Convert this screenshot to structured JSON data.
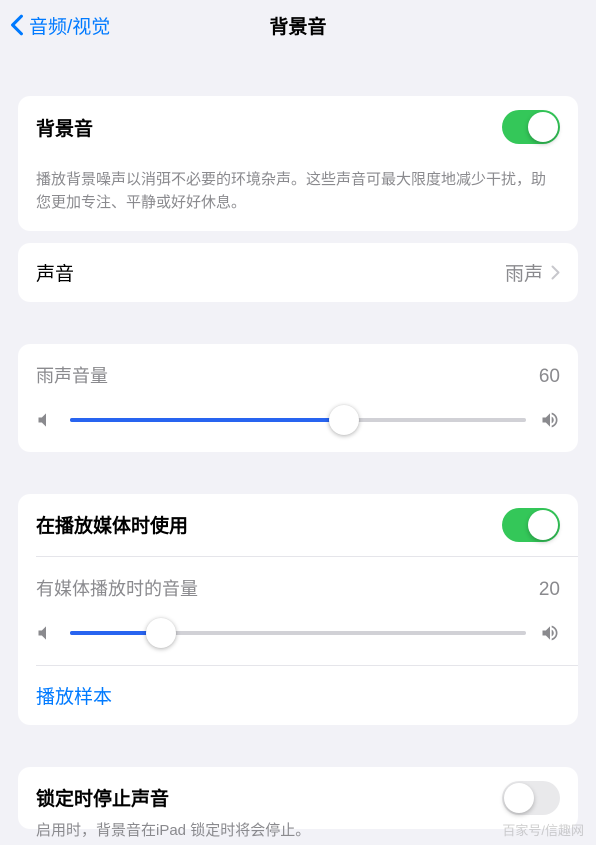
{
  "header": {
    "back_label": "音频/视觉",
    "title": "背景音"
  },
  "main_toggle": {
    "label": "背景音",
    "on": true,
    "description": "播放背景噪声以消弭不必要的环境杂声。这些声音可最大限度地减少干扰，助您更加专注、平静或好好休息。"
  },
  "sound_select": {
    "label": "声音",
    "value": "雨声"
  },
  "rain_volume": {
    "label": "雨声音量",
    "value": 60
  },
  "media": {
    "use_label": "在播放媒体时使用",
    "use_on": true,
    "volume_label": "有媒体播放时的音量",
    "volume_value": 20,
    "sample_label": "播放样本"
  },
  "lock": {
    "label": "锁定时停止声音",
    "on": false,
    "description": "启用时，背景音在iPad 锁定时将会停止。"
  },
  "watermark": "百家号/信趣网"
}
